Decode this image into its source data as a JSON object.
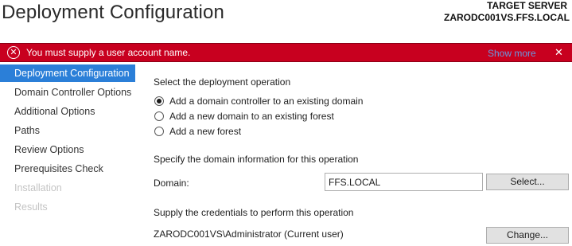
{
  "header": {
    "title": "Deployment Configuration",
    "target_server_label": "TARGET SERVER",
    "target_server_value": "ZARODC001VS.FFS.LOCAL"
  },
  "error_bar": {
    "icon": "error-circle-x-icon",
    "message": "You must supply a user account name.",
    "show_more_label": "Show more",
    "close_label": "✕",
    "color": "#c8001f"
  },
  "sidebar": {
    "accent_color": "#2b7fd8",
    "items": [
      {
        "label": "Deployment Configuration",
        "state": "active"
      },
      {
        "label": "Domain Controller Options",
        "state": "normal"
      },
      {
        "label": "Additional Options",
        "state": "normal"
      },
      {
        "label": "Paths",
        "state": "normal"
      },
      {
        "label": "Review Options",
        "state": "normal"
      },
      {
        "label": "Prerequisites Check",
        "state": "normal"
      },
      {
        "label": "Installation",
        "state": "disabled"
      },
      {
        "label": "Results",
        "state": "disabled"
      }
    ]
  },
  "main": {
    "operation_heading": "Select the deployment operation",
    "operations": [
      {
        "label": "Add a domain controller to an existing domain",
        "checked": true
      },
      {
        "label": "Add a new domain to an existing forest",
        "checked": false
      },
      {
        "label": "Add a new forest",
        "checked": false
      }
    ],
    "domain_heading": "Specify the domain information for this operation",
    "domain_label": "Domain:",
    "domain_value": "FFS.LOCAL",
    "select_button": "Select...",
    "credentials_heading": "Supply the credentials to perform this operation",
    "credentials_user": "ZARODC001VS\\Administrator (Current user)",
    "change_button": "Change..."
  }
}
